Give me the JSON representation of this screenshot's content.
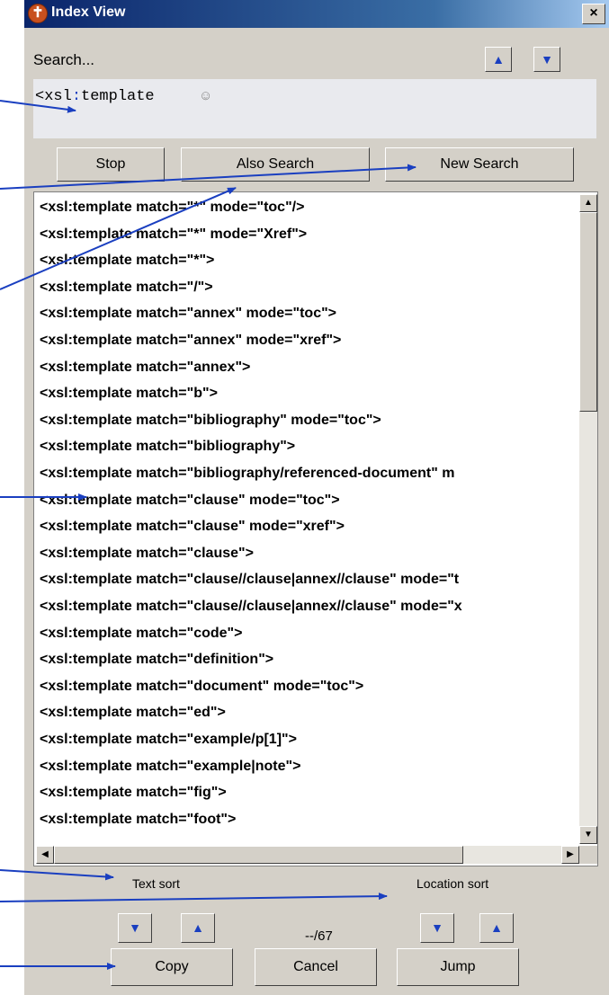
{
  "window": {
    "title": "Index View",
    "close_symbol": "×"
  },
  "search": {
    "label": "Search...",
    "query_part1": "<xsl",
    "query_colon": ":",
    "query_part2": "template",
    "up_symbol": "▲",
    "down_symbol": "▼"
  },
  "buttons": {
    "stop": "Stop",
    "also_search": "Also Search",
    "new_search": "New Search",
    "copy": "Copy",
    "cancel": "Cancel",
    "jump": "Jump"
  },
  "results": [
    "<xsl:template match=\"*\" mode=\"toc\"/>",
    "<xsl:template match=\"*\" mode=\"Xref\">",
    "<xsl:template match=\"*\">",
    "<xsl:template match=\"/\">",
    "<xsl:template match=\"annex\" mode=\"toc\">",
    "<xsl:template match=\"annex\" mode=\"xref\">",
    "<xsl:template match=\"annex\">",
    "<xsl:template match=\"b\">",
    "<xsl:template match=\"bibliography\" mode=\"toc\">",
    "<xsl:template match=\"bibliography\">",
    "<xsl:template match=\"bibliography/referenced-document\" m",
    "<xsl:template match=\"clause\" mode=\"toc\">",
    "<xsl:template match=\"clause\" mode=\"xref\">",
    "<xsl:template match=\"clause\">",
    "<xsl:template match=\"clause//clause|annex//clause\" mode=\"t",
    "<xsl:template match=\"clause//clause|annex//clause\" mode=\"x",
    "<xsl:template match=\"code\">",
    "<xsl:template match=\"definition\">",
    "<xsl:template match=\"document\" mode=\"toc\">",
    "<xsl:template match=\"ed\">",
    "<xsl:template match=\"example/p[1]\">",
    "<xsl:template match=\"example|note\">",
    "<xsl:template match=\"fig\">",
    "<xsl:template match=\"foot\">"
  ],
  "sort": {
    "text_sort": "Text sort",
    "location_sort": "Location sort"
  },
  "counter": "--/67",
  "colors": {
    "arrow": "#1a3fc0",
    "title_bar": "#0a246a",
    "panel": "#d4d0c8"
  },
  "icons": {
    "title": "app-logo-icon",
    "close": "close-icon",
    "up": "chevron-up-icon",
    "down": "chevron-down-icon",
    "smiley": "smiley-icon"
  }
}
